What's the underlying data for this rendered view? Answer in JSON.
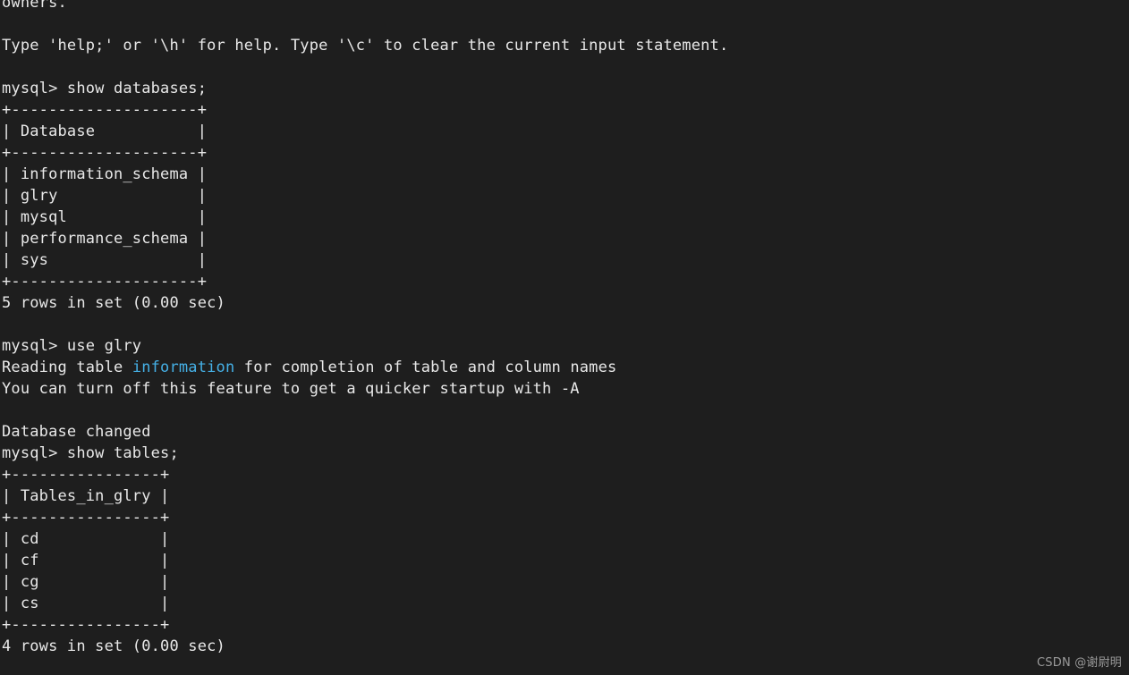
{
  "terminal": {
    "colors": {
      "background": "#1e1e1e",
      "foreground": "#e8e8e8",
      "highlight": "#45b0e6",
      "watermark": "#9a9a9a"
    },
    "lines": [
      {
        "id": "l01",
        "text": "owners."
      },
      {
        "id": "l02",
        "text": ""
      },
      {
        "id": "l03",
        "text": "Type 'help;' or '\\h' for help. Type '\\c' to clear the current input statement."
      },
      {
        "id": "l04",
        "text": ""
      },
      {
        "id": "l05",
        "text": "mysql> show databases;"
      },
      {
        "id": "l06",
        "text": "+--------------------+"
      },
      {
        "id": "l07",
        "text": "| Database           |"
      },
      {
        "id": "l08",
        "text": "+--------------------+"
      },
      {
        "id": "l09",
        "text": "| information_schema |"
      },
      {
        "id": "l10",
        "text": "| glry               |"
      },
      {
        "id": "l11",
        "text": "| mysql              |"
      },
      {
        "id": "l12",
        "text": "| performance_schema |"
      },
      {
        "id": "l13",
        "text": "| sys                |"
      },
      {
        "id": "l14",
        "text": "+--------------------+"
      },
      {
        "id": "l15",
        "text": "5 rows in set (0.00 sec)"
      },
      {
        "id": "l16",
        "text": ""
      },
      {
        "id": "l17",
        "text": "mysql> use glry"
      },
      {
        "id": "l18",
        "segments": [
          {
            "text": "Reading table "
          },
          {
            "text": "information",
            "style": "highlight"
          },
          {
            "text": " for completion of table and column names"
          }
        ]
      },
      {
        "id": "l19",
        "text": "You can turn off this feature to get a quicker startup with -A"
      },
      {
        "id": "l20",
        "text": ""
      },
      {
        "id": "l21",
        "text": "Database changed"
      },
      {
        "id": "l22",
        "text": "mysql> show tables;"
      },
      {
        "id": "l23",
        "text": "+----------------+"
      },
      {
        "id": "l24",
        "text": "| Tables_in_glry |"
      },
      {
        "id": "l25",
        "text": "+----------------+"
      },
      {
        "id": "l26",
        "text": "| cd             |"
      },
      {
        "id": "l27",
        "text": "| cf             |"
      },
      {
        "id": "l28",
        "text": "| cg             |"
      },
      {
        "id": "l29",
        "text": "| cs             |"
      },
      {
        "id": "l30",
        "text": "+----------------+"
      },
      {
        "id": "l31",
        "text": "4 rows in set (0.00 sec)"
      }
    ],
    "queries": [
      {
        "prompt": "mysql>",
        "command": "show databases;"
      },
      {
        "prompt": "mysql>",
        "command": "use glry"
      },
      {
        "prompt": "mysql>",
        "command": "show tables;"
      }
    ],
    "databases_result": {
      "header": "Database",
      "rows": [
        "information_schema",
        "glry",
        "mysql",
        "performance_schema",
        "sys"
      ],
      "status": "5 rows in set (0.00 sec)"
    },
    "tables_result": {
      "header": "Tables_in_glry",
      "rows": [
        "cd",
        "cf",
        "cg",
        "cs"
      ],
      "status": "4 rows in set (0.00 sec)"
    },
    "messages": {
      "help_hint": "Type 'help;' or '\\h' for help. Type '\\c' to clear the current input statement.",
      "reading_table_prefix": "Reading table ",
      "reading_table_highlight": "information",
      "reading_table_suffix": " for completion of table and column names",
      "turn_off_hint": "You can turn off this feature to get a quicker startup with -A",
      "database_changed": "Database changed",
      "owners_tail": "owners."
    }
  },
  "watermark": {
    "text": "CSDN @谢尉明"
  }
}
